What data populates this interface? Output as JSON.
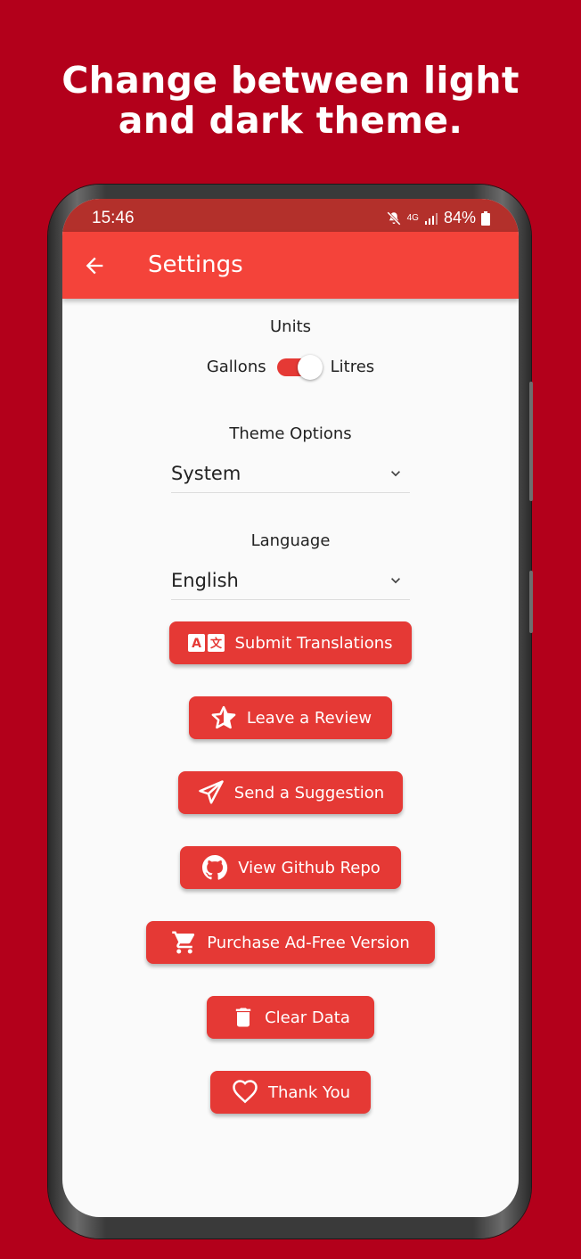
{
  "promo": {
    "line1": "Change between light",
    "line2": "and dark theme."
  },
  "status_bar": {
    "time": "15:46",
    "network": "4G",
    "battery": "84%"
  },
  "app_bar": {
    "title": "Settings"
  },
  "units": {
    "label": "Units",
    "left_option": "Gallons",
    "right_option": "Litres",
    "selected": "Litres"
  },
  "theme": {
    "label": "Theme Options",
    "value": "System"
  },
  "language": {
    "label": "Language",
    "value": "English"
  },
  "buttons": {
    "submit_translations": "Submit Translations",
    "leave_review": "Leave a Review",
    "send_suggestion": "Send a Suggestion",
    "view_github": "View Github Repo",
    "purchase_ad_free": "Purchase Ad-Free Version",
    "clear_data": "Clear Data",
    "thank_you": "Thank You"
  },
  "colors": {
    "background": "#b3001b",
    "app_bar": "#f4433a",
    "accent": "#e53935",
    "screen": "#fafafa"
  }
}
